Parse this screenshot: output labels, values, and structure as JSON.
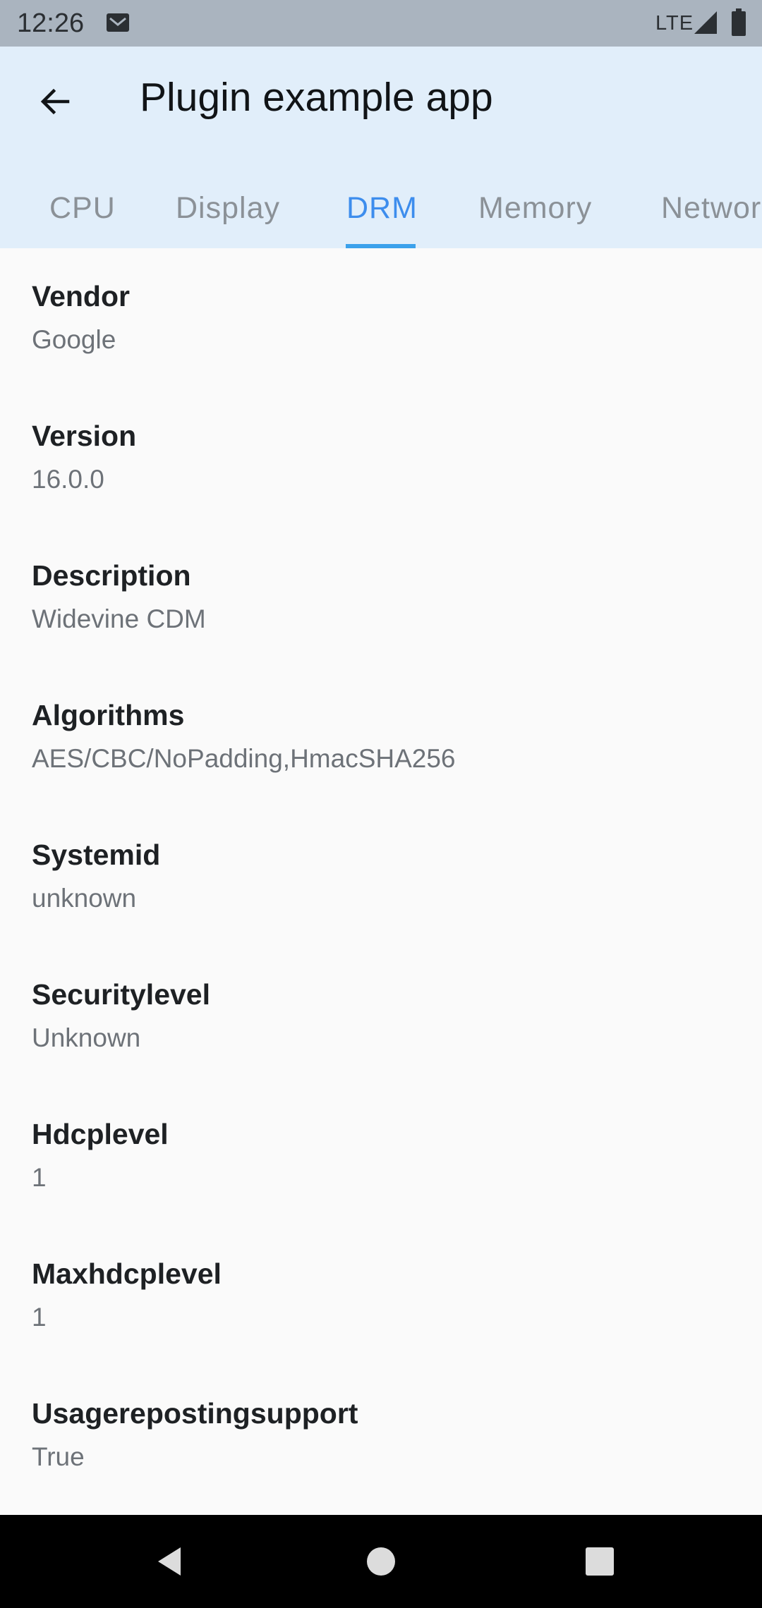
{
  "status_bar": {
    "time": "12:26",
    "network": "LTE",
    "icons": [
      "mail-icon",
      "signal-icon",
      "battery-icon"
    ]
  },
  "app_bar": {
    "title": "Plugin example app",
    "back_icon": "arrow-back-icon"
  },
  "tabs": [
    {
      "label": "CPU",
      "active": false
    },
    {
      "label": "Display",
      "active": false
    },
    {
      "label": "DRM",
      "active": true
    },
    {
      "label": "Memory",
      "active": false
    },
    {
      "label": "Network",
      "active": false
    }
  ],
  "drm_info": [
    {
      "title": "Vendor",
      "value": "Google"
    },
    {
      "title": "Version",
      "value": "16.0.0"
    },
    {
      "title": "Description",
      "value": "Widevine CDM"
    },
    {
      "title": "Algorithms",
      "value": "AES/CBC/NoPadding,HmacSHA256"
    },
    {
      "title": "Systemid",
      "value": "unknown"
    },
    {
      "title": "Securitylevel",
      "value": "Unknown"
    },
    {
      "title": "Hdcplevel",
      "value": "1"
    },
    {
      "title": "Maxhdcplevel",
      "value": "1"
    },
    {
      "title": "Usagerepostingsupport",
      "value": "True"
    }
  ],
  "nav_bar": {
    "icons": [
      "nav-back-icon",
      "nav-home-icon",
      "nav-recents-icon"
    ]
  },
  "colors": {
    "status_bar": "#aab4bf",
    "app_bar": "#e1eefa",
    "accent": "#3d8ded",
    "indicator": "#3ba1eb",
    "background": "#fafafa"
  }
}
